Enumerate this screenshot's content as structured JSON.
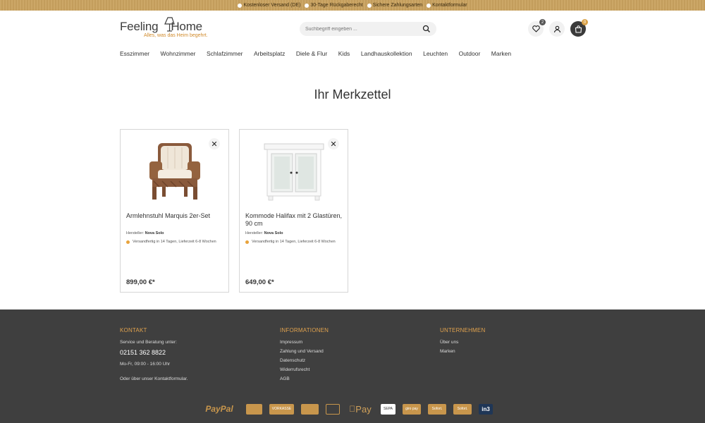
{
  "topbar": {
    "usps": [
      "Kostenloser Versand (DE)",
      "30-Tage Rückgaberecht",
      "Sichere Zahlungsarten",
      "Kontaktformular"
    ]
  },
  "header": {
    "logo_word_a": "Feeling",
    "logo_word_b": "Home",
    "logo_tagline": "Alles, was das Heim begehrt.",
    "search_placeholder": "Suchbegriff eingeben ...",
    "wishlist_count": "2",
    "cart_count": "0"
  },
  "nav": {
    "items": [
      "Esszimmer",
      "Wohnzimmer",
      "Schlafzimmer",
      "Arbeitsplatz",
      "Diele & Flur",
      "Kids",
      "Landhauskollektion",
      "Leuchten",
      "Outdoor",
      "Marken"
    ]
  },
  "main": {
    "title": "Ihr Merkzettel",
    "products": [
      {
        "name": "Armlehnstuhl Marquis 2er-Set",
        "maker_label": "Hersteller:",
        "maker": "Nova Solo",
        "availability": "Versandfertig in 14 Tagen, Lieferzeit 6-8 Wochen",
        "price": "899,00 €*"
      },
      {
        "name": "Kommode Halifax mit 2 Glastüren, 90 cm",
        "maker_label": "Hersteller:",
        "maker": "Nova Solo",
        "availability": "Versandfertig in 14 Tagen, Lieferzeit 6-8 Wochen",
        "price": "649,00 €*"
      }
    ],
    "remove_glyph": "✕"
  },
  "footer": {
    "kontakt": {
      "heading": "KONTAKT",
      "intro": "Service und Beratung unter:",
      "phone": "02151 362 8822",
      "hours": "Mo-Fr, 09:00 - 16:00 Uhr",
      "form_note": "Oder über unser Kontaktformular."
    },
    "informationen": {
      "heading": "INFORMATIONEN",
      "links": [
        "Impressum",
        "Zahlung und Versand",
        "Datenschutz",
        "Widerrufsrecht",
        "AGB"
      ]
    },
    "unternehmen": {
      "heading": "UNTERNEHMEN",
      "links": [
        "Über uns",
        "Marken"
      ]
    },
    "payments": {
      "paypal": "PayPal",
      "vorkasse": "VORKASSE",
      "applepay": "Pay",
      "sepa": "SEPA",
      "giropay": "giro pay",
      "sofort1": "Sofort.",
      "sofort2": "Sofort.",
      "in3": "in3"
    }
  },
  "colors": {
    "topbar": "#c9a25f",
    "accent": "#e0a24e",
    "footer_bg": "#3f3f3f",
    "availability_dot": "#e8a33c"
  }
}
